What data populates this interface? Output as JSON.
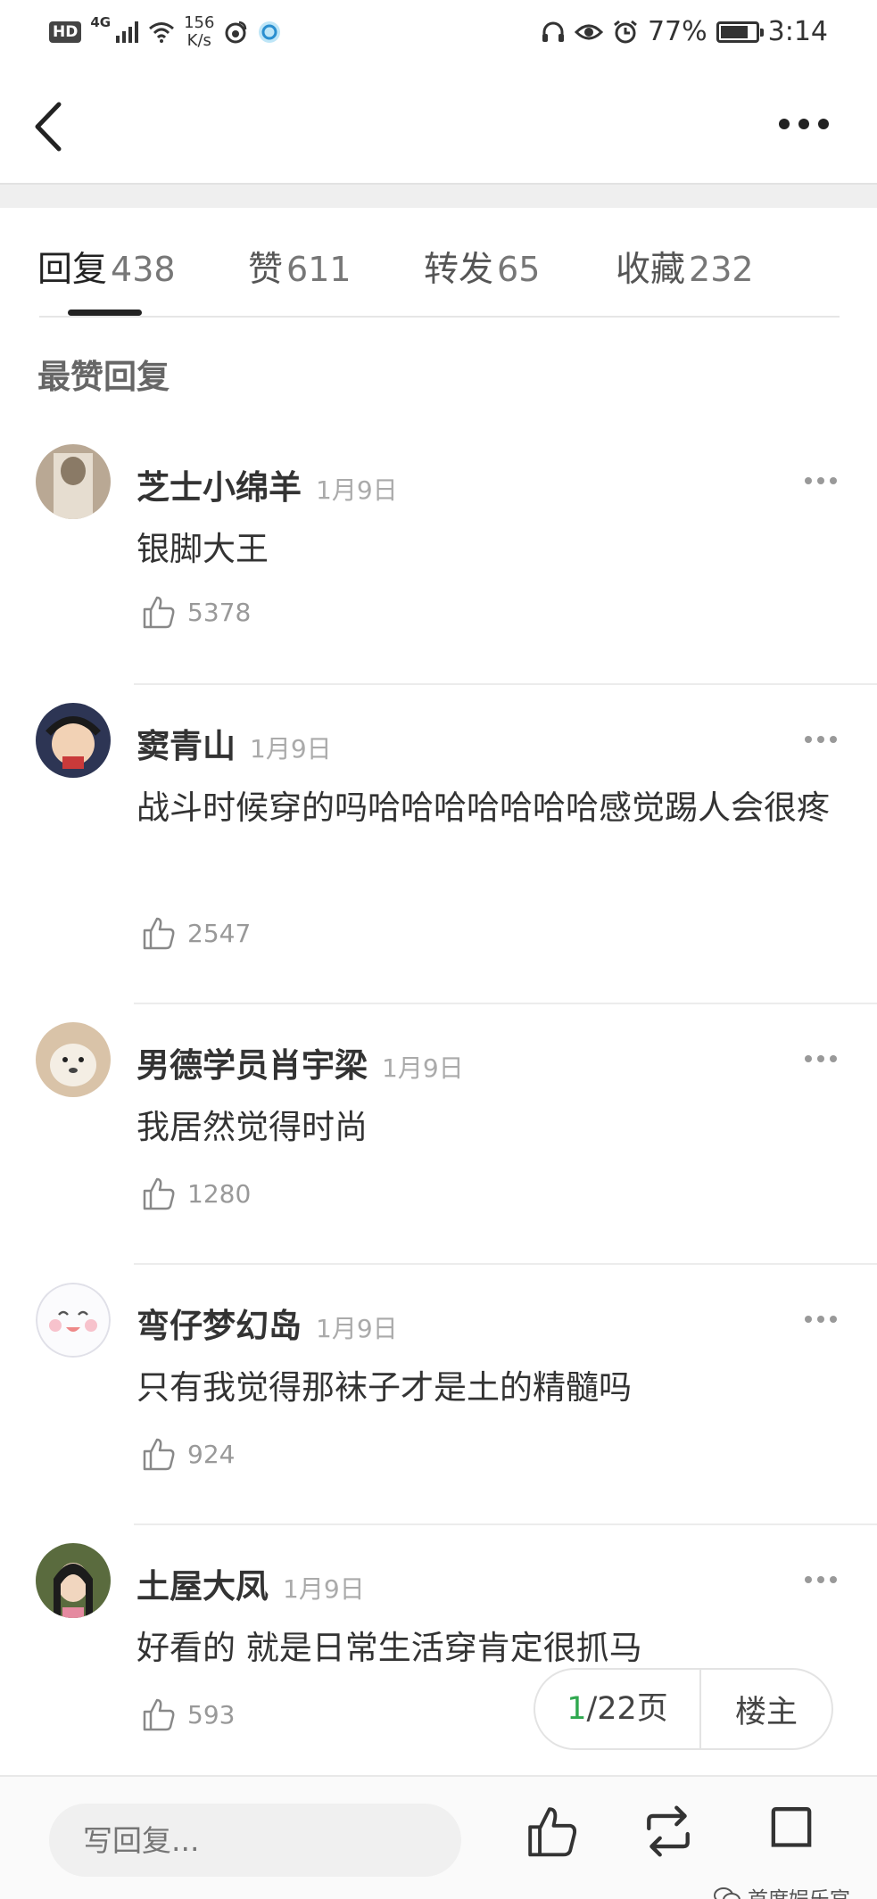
{
  "status_bar": {
    "hd": "HD",
    "network": "4G",
    "speed_value": "156",
    "speed_unit": "K/s",
    "battery_percent": "77%",
    "battery_level": 0.77,
    "time": "3:14"
  },
  "tabs": [
    {
      "label": "回复",
      "count": "438"
    },
    {
      "label": "赞",
      "count": "611"
    },
    {
      "label": "转发",
      "count": "65"
    },
    {
      "label": "收藏",
      "count": "232"
    }
  ],
  "section_title": "最赞回复",
  "comments": [
    {
      "name": "芝士小绵羊",
      "date": "1月9日",
      "text": "银脚大王",
      "likes": "5378"
    },
    {
      "name": "窦青山",
      "date": "1月9日",
      "text": "战斗时候穿的吗哈哈哈哈哈哈哈感觉踢人会很疼",
      "likes": "2547"
    },
    {
      "name": "男德学员肖宇梁",
      "date": "1月9日",
      "text": "我居然觉得时尚",
      "likes": "1280"
    },
    {
      "name": "弯仔梦幻岛",
      "date": "1月9日",
      "text": "只有我觉得那袜子才是土的精髓吗",
      "likes": "924"
    },
    {
      "name": "土屋大凤",
      "date": "1月9日",
      "text": "好看的 就是日常生活穿肯定很抓马",
      "likes": "593"
    }
  ],
  "pager": {
    "current": "1",
    "total_label": "/22页",
    "op_label": "楼主"
  },
  "bottom": {
    "reply_placeholder": "写回复...",
    "watermark": "首席娱乐官"
  },
  "colors": {
    "accent_green": "#2fa84f",
    "text": "#333333",
    "muted": "#999999"
  }
}
